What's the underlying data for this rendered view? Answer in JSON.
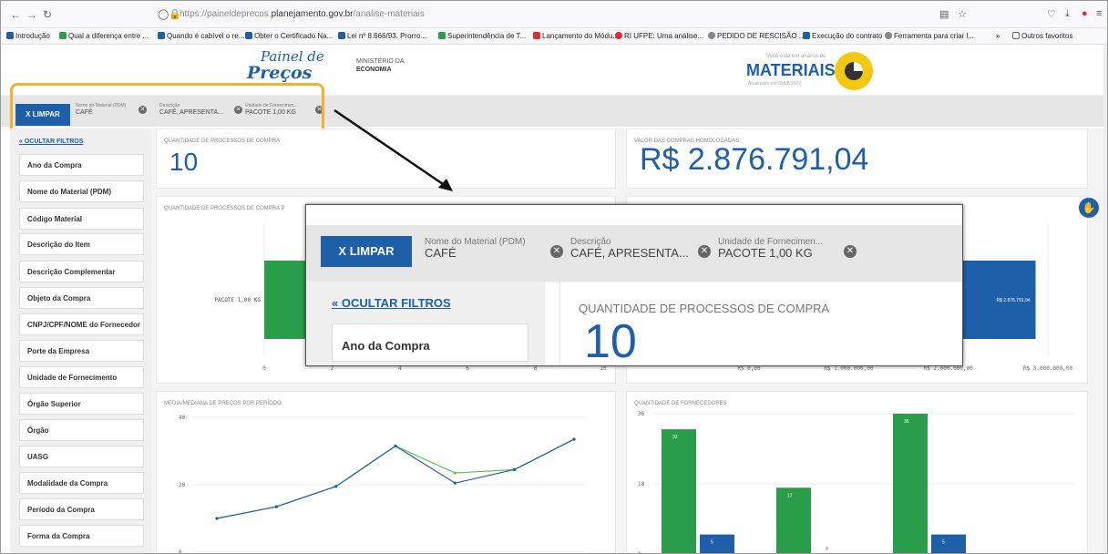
{
  "browser": {
    "url_host": "https://paineldeprecos.",
    "url_domain": "planejamento.gov.br",
    "url_path": "/analise-materiais",
    "bookmarks": [
      "Introdução",
      "Qual a diferença entre ...",
      "Quando é cabível o re...",
      "Obter o Certificado Na...",
      "Lei nº 8.666/93. Prorro...",
      "Superintendência de T...",
      "Lançamento do Módu...",
      "RI UFPE: Uma análise...",
      "PEDIDO DE RESCISÃO ...",
      "Execução do contrato",
      "Ferramenta para criar l..."
    ],
    "other_bookmarks": "Outros favoritos",
    "overflow": "»",
    "colors": {
      "youtube": "#e32b2b",
      "orange": "#f29b1d",
      "blue": "#1d5fa8",
      "green": "#2a9d4a"
    }
  },
  "header": {
    "logo_line1": "Painel de",
    "logo_line2": "Preços",
    "ministry_line1": "MINISTÉRIO DA",
    "ministry_line2": "ECONOMIA",
    "context_small": "Você está em análise de",
    "context_title": "MATERIAIS",
    "updated": "Atualizado em 09/08/2022"
  },
  "filters": {
    "clear_label": "X LIMPAR",
    "chips": [
      {
        "label": "Nome do Material (PDM)",
        "value": "CAFÉ"
      },
      {
        "label": "Descrição",
        "value": "CAFÉ, APRESENTA..."
      },
      {
        "label": "Unidade de Fornecimen...",
        "value": "PACOTE 1,00 KG"
      }
    ],
    "remove_glyph": "✕"
  },
  "sidebar": {
    "hide_label": "« OCULTAR FILTROS",
    "items": [
      "Ano da Compra",
      "Nome do Material (PDM)",
      "Código Material",
      "Descrição do Item",
      "Descrição Complementar",
      "Objeto da Compra",
      "CNPJ/CPF/NOME do Fornecedor",
      "Porte da Empresa",
      "Unidade de Fornecimento",
      "Órgão Superior",
      "Órgão",
      "UASG",
      "Modalidade da Compra",
      "Período da Compra",
      "Forma da Compra"
    ]
  },
  "cards": {
    "processes_title": "QUANTIDADE DE PROCESSOS DE COMPRA",
    "processes_value": "10",
    "value_title": "VALOR DAS COMPRAS HOMOLOGADAS",
    "value_value": "R$ 2.876.791,04",
    "processes_chart_title": "QUANTIDADE DE PROCESSOS DE COMPRA P",
    "value_chart_bar_label": "R$ 2.876.791,04",
    "price_chart_title": "MÉDIA/MEDIANA DE PREÇOS POR PERÍODO",
    "suppliers_title": "QUANTIDADE DE FORNECEDORES"
  },
  "chart_data": [
    {
      "type": "bar",
      "title": "QUANTIDADE DE PROCESSOS DE COMPRA P",
      "categories": [
        "PACOTE 1,00 KG"
      ],
      "values": [
        10
      ],
      "xticks": [
        "0",
        "2",
        "4",
        "6",
        "8",
        "10"
      ],
      "xlim": [
        0,
        10
      ],
      "color": "#2a9d4a"
    },
    {
      "type": "bar",
      "title": "",
      "categories": [
        "PACOTE 1,00 KG"
      ],
      "values": [
        2876791.04
      ],
      "data_labels": [
        "R$ 2.876.791,04"
      ],
      "xticks": [
        "R$ 0,00",
        "R$ 1.000.000,00",
        "R$ 2.000.000,00",
        "R$ 3.000.000,00"
      ],
      "xlim": [
        0,
        3000000
      ],
      "color": "#1d5fa8"
    },
    {
      "type": "line",
      "title": "MÉDIA/MEDIANA DE PREÇOS POR PERÍODO",
      "yticks": [
        "0",
        "20",
        "40"
      ],
      "ylim": [
        0,
        40
      ],
      "x": [
        1,
        2,
        3,
        4,
        5,
        6,
        7
      ],
      "series": [
        {
          "color": "#1d5fa8",
          "values": [
            10,
            13.5,
            19.5,
            31.5,
            20.5,
            24.5,
            33.5
          ]
        },
        {
          "color": "#6abf4b",
          "values": [
            10,
            13.5,
            19.5,
            31.5,
            23.5,
            24.5,
            33.5
          ]
        }
      ]
    },
    {
      "type": "bar",
      "title": "QUANTIDADE DE FORNECEDORES",
      "yticks": [
        "0",
        "18",
        "36"
      ],
      "ylim": [
        0,
        36
      ],
      "groups": [
        {
          "values": [
            32,
            5
          ],
          "labels": [
            "32",
            "5"
          ]
        },
        {
          "values": [
            17,
            0
          ],
          "labels": [
            "17",
            "0"
          ]
        },
        {
          "values": [
            36,
            5
          ],
          "labels": [
            "36",
            "5"
          ]
        }
      ],
      "colors": [
        "#2a9d4a",
        "#1d5fa8"
      ]
    }
  ],
  "zoom_inset": {
    "clear_label": "X LIMPAR",
    "chips": [
      {
        "label": "Nome do Material (PDM)",
        "value": "CAFÉ"
      },
      {
        "label": "Descrição",
        "value": "CAFÉ, APRESENTA..."
      },
      {
        "label": "Unidade de Fornecimen...",
        "value": "PACOTE 1,00 KG"
      }
    ],
    "hide_label": "« OCULTAR FILTROS",
    "first_filter": "Ano da Compra",
    "card_title": "QUANTIDADE DE PROCESSOS DE COMPRA",
    "card_value": "10"
  }
}
